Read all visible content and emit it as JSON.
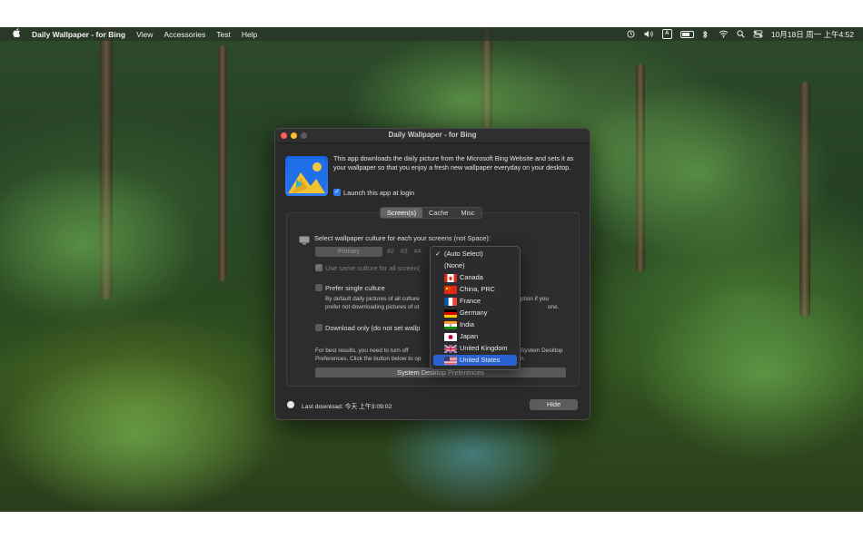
{
  "menubar": {
    "app_name": "Daily Wallpaper - for Bing",
    "menus": [
      "View",
      "Accessories",
      "Test",
      "Help"
    ],
    "clock": "10月18日 周一 上午4:52",
    "ime_label": "A",
    "icons": [
      "apple-icon",
      "time-machine-icon",
      "volume-icon",
      "input-source-icon",
      "battery-icon",
      "bluetooth-icon",
      "wifi-icon",
      "spotlight-icon",
      "control-center-icon"
    ]
  },
  "window": {
    "title": "Daily Wallpaper - for Bing",
    "intro": "This app downloads the daily picture from the Microsoft Bing Website and sets it as your wallpaper so that you enjoy a fresh new wallpaper everyday on your desktop.",
    "launch_at_login": "Launch this app at login",
    "tabs": [
      "Screen(s)",
      "Cache",
      "Misc"
    ],
    "select_culture_label": "Select wallpaper culture for each your screens (not Space):",
    "screens": [
      "Primary",
      "#2",
      "#3",
      "#4"
    ],
    "same_culture": "Use same culture for all screen(",
    "prefer_single": "Prefer single culture",
    "prefer_single_desc_1": "By default daily pictures of all culture",
    "prefer_single_desc_1b": "ption if you",
    "prefer_single_desc_2": "prefer not downloading pictures of ot",
    "prefer_single_desc_2b": "one.",
    "download_only": "Download only (do not set wallp",
    "best_results_1": "For best results, you need to turn off",
    "best_results_1b": "System Desktop",
    "best_results_2": "Preferences. Click the button below to op",
    "best_results_2b": "n.",
    "sys_button": "System Desktop Preferences",
    "last_download": "Last download: 今天 上午3:09:02",
    "hide_button": "Hide"
  },
  "dropdown": {
    "items": [
      {
        "label": "(Auto Select)",
        "checked": true
      },
      {
        "label": "(None)"
      },
      {
        "label": "Canada",
        "flag": "ca"
      },
      {
        "label": "China, PRC",
        "flag": "cn"
      },
      {
        "label": "France",
        "flag": "fr"
      },
      {
        "label": "Germany",
        "flag": "de"
      },
      {
        "label": "India",
        "flag": "in"
      },
      {
        "label": "Japan",
        "flag": "jp"
      },
      {
        "label": "United Kingdom",
        "flag": "gb"
      },
      {
        "label": "United States",
        "flag": "us",
        "highlighted": true
      }
    ],
    "checkmark": "✓"
  },
  "colors": {
    "accent": "#2a62d2",
    "window_bg": "#2a2a2b"
  }
}
